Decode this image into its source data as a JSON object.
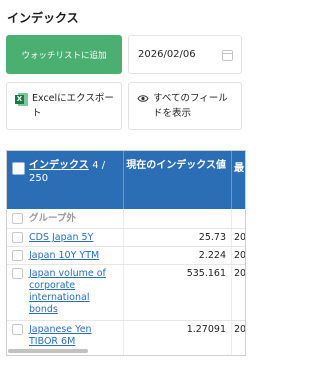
{
  "header": {
    "title": "インデックス"
  },
  "toolbar": {
    "watchlist_label": "ウォッチリストに追加",
    "date_value": "2026/02/06",
    "excel_label": "Excelにエクスポート",
    "fields_label": "すべてのフィールドを表示"
  },
  "table": {
    "col_index_label": "インデックス",
    "col_index_count": "4 / 250",
    "col_value_label": "現在のインデックス値",
    "col_third_label": "最",
    "group_label": "グループ外",
    "rows": [
      {
        "name": "CDS Japan 5Y",
        "value": "25.73",
        "third": "20"
      },
      {
        "name": "Japan 10Y YTM",
        "value": "2.224",
        "third": "20"
      },
      {
        "name": "Japan volume of corporate international bonds",
        "value": "535.161",
        "third": "20"
      },
      {
        "name": "Japanese Yen TIBOR 6M",
        "value": "1.27091",
        "third": "20"
      }
    ]
  },
  "colors": {
    "accent_green": "#4caf72",
    "header_blue": "#2b6eb5",
    "link_blue": "#2b6eb5"
  },
  "icons": [
    "calendar-icon",
    "excel-icon",
    "eye-icon"
  ]
}
